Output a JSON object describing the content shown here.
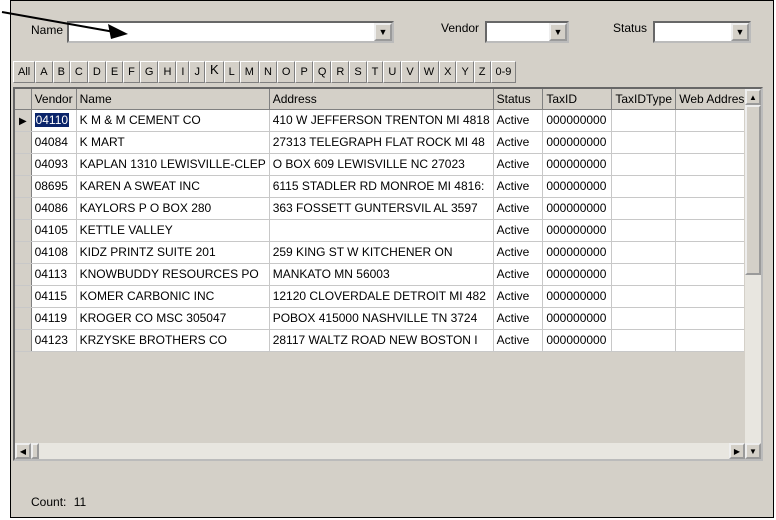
{
  "filters": {
    "name_label": "Name",
    "vendor_label": "Vendor",
    "status_label": "Status",
    "name_value": "",
    "vendor_value": "",
    "status_value": ""
  },
  "alphabet": [
    "All",
    "A",
    "B",
    "C",
    "D",
    "E",
    "F",
    "G",
    "H",
    "I",
    "J",
    "K",
    "L",
    "M",
    "N",
    "O",
    "P",
    "Q",
    "R",
    "S",
    "T",
    "U",
    "V",
    "W",
    "X",
    "Y",
    "Z",
    "0-9"
  ],
  "active_letter": "K",
  "grid": {
    "columns": [
      "Vendor",
      "Name",
      "Address",
      "Status",
      "TaxID",
      "TaxIDType",
      "Web Address"
    ],
    "rows": [
      {
        "vendor": "04110",
        "name": "K M & M CEMENT CO",
        "address": "410 W JEFFERSON  TRENTON MI 4818",
        "status": "Active",
        "taxid": "000000000",
        "taxidtype": "",
        "web": ""
      },
      {
        "vendor": "04084",
        "name": "K MART",
        "address": "27313 TELEGRAPH  FLAT ROCK MI 48",
        "status": "Active",
        "taxid": "000000000",
        "taxidtype": "",
        "web": ""
      },
      {
        "vendor": "04093",
        "name": "KAPLAN 1310 LEWISVILLE-CLEP",
        "address": "O BOX 609  LEWISVILLE NC 27023",
        "status": "Active",
        "taxid": "000000000",
        "taxidtype": "",
        "web": ""
      },
      {
        "vendor": "08695",
        "name": "KAREN A SWEAT INC",
        "address": "6115 STADLER RD  MONROE MI 4816:",
        "status": "Active",
        "taxid": "000000000",
        "taxidtype": "",
        "web": ""
      },
      {
        "vendor": "04086",
        "name": "KAYLORS P O BOX 280",
        "address": "363 FOSSETT  GUNTERSVIL AL 3597",
        "status": "Active",
        "taxid": "000000000",
        "taxidtype": "",
        "web": ""
      },
      {
        "vendor": "04105",
        "name": "KETTLE VALLEY",
        "address": "",
        "status": "Active",
        "taxid": "000000000",
        "taxidtype": "",
        "web": ""
      },
      {
        "vendor": "04108",
        "name": "KIDZ PRINTZ SUITE 201",
        "address": "259 KING ST W  KITCHENER ON",
        "status": "Active",
        "taxid": "000000000",
        "taxidtype": "",
        "web": ""
      },
      {
        "vendor": "04113",
        "name": "KNOWBUDDY RESOURCES PO",
        "address": "  MANKATO MN 56003",
        "status": "Active",
        "taxid": "000000000",
        "taxidtype": "",
        "web": ""
      },
      {
        "vendor": "04115",
        "name": "KOMER CARBONIC INC",
        "address": "12120 CLOVERDALE  DETROIT MI 482",
        "status": "Active",
        "taxid": "000000000",
        "taxidtype": "",
        "web": ""
      },
      {
        "vendor": "04119",
        "name": "KROGER CO MSC 305047",
        "address": "POBOX 415000  NASHVILLE TN 3724",
        "status": "Active",
        "taxid": "000000000",
        "taxidtype": "",
        "web": ""
      },
      {
        "vendor": "04123",
        "name": "KRZYSKE BROTHERS CO",
        "address": "28117 WALTZ ROAD  NEW BOSTON I",
        "status": "Active",
        "taxid": "000000000",
        "taxidtype": "",
        "web": ""
      }
    ]
  },
  "footer": {
    "count_label": "Count:",
    "count_value": "11"
  }
}
